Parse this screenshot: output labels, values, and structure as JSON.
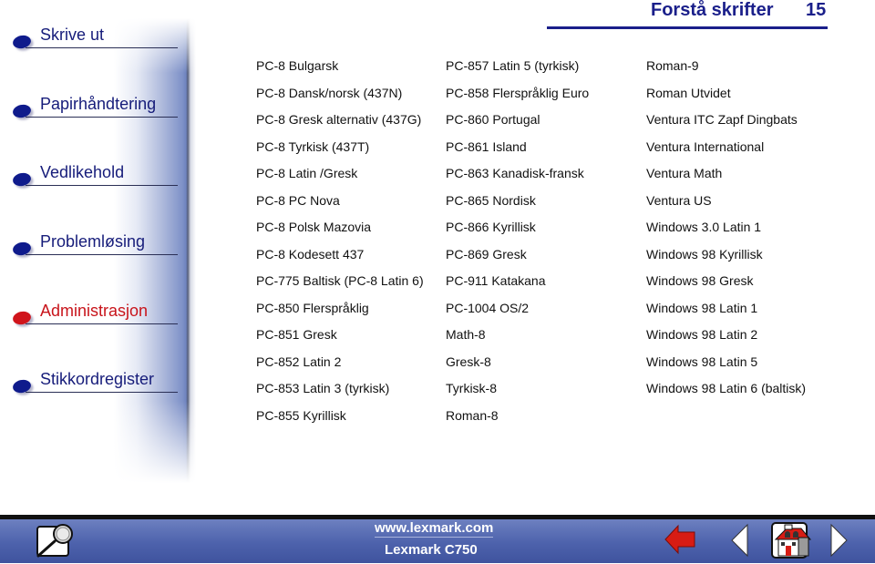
{
  "header": {
    "title": "Forstå skrifter",
    "page_number": "15"
  },
  "sidebar": {
    "items": [
      {
        "label": "Skrive ut",
        "active": false
      },
      {
        "label": "Papirhåndtering",
        "active": false
      },
      {
        "label": "Vedlikehold",
        "active": false
      },
      {
        "label": "Problemløsing",
        "active": false
      },
      {
        "label": "Administrasjon",
        "active": true
      },
      {
        "label": "Stikkordregister",
        "active": false
      }
    ]
  },
  "symbol_sets": {
    "columns": [
      [
        "PC-8 Bulgarsk",
        "PC-8 Dansk/norsk (437N)",
        "PC-8 Gresk alternativ (437G)",
        "PC-8 Tyrkisk (437T)",
        "PC-8 Latin /Gresk",
        "PC-8 PC Nova",
        "PC-8 Polsk Mazovia",
        "PC-8 Kodesett 437",
        "PC-775 Baltisk (PC-8 Latin 6)",
        "PC-850 Flerspråklig",
        "PC-851 Gresk",
        "PC-852 Latin 2",
        "PC-853 Latin 3 (tyrkisk)",
        "PC-855 Kyrillisk"
      ],
      [
        "PC-857 Latin 5 (tyrkisk)",
        "PC-858 Flerspråklig Euro",
        "PC-860 Portugal",
        "PC-861 Island",
        "PC-863 Kanadisk-fransk",
        "PC-865 Nordisk",
        "PC-866 Kyrillisk",
        "PC-869 Gresk",
        "PC-911 Katakana",
        "PC-1004 OS/2",
        "Math-8",
        "Gresk-8",
        "Tyrkisk-8",
        "Roman-8"
      ],
      [
        "Roman-9",
        "Roman Utvidet",
        "Ventura ITC Zapf Dingbats",
        "Ventura International",
        "Ventura Math",
        "Ventura US",
        "Windows 3.0 Latin 1",
        "Windows 98 Kyrillisk",
        "Windows 98 Gresk",
        "Windows 98 Latin 1",
        "Windows 98 Latin 2",
        "Windows 98 Latin 5",
        "Windows 98 Latin 6 (baltisk)"
      ]
    ]
  },
  "footer": {
    "url": "www.lexmark.com",
    "product": "Lexmark C750",
    "icons": {
      "search": "magnifier-search-icon",
      "back": "red-back-arrow-icon",
      "prev": "previous-page-triangle-icon",
      "home": "home-house-icon",
      "next": "next-page-triangle-icon"
    }
  },
  "colors": {
    "nav_text": "#161c7a",
    "nav_active": "#c8141b",
    "header": "#1a1f8a",
    "footer_bar": "#4d62ac"
  }
}
